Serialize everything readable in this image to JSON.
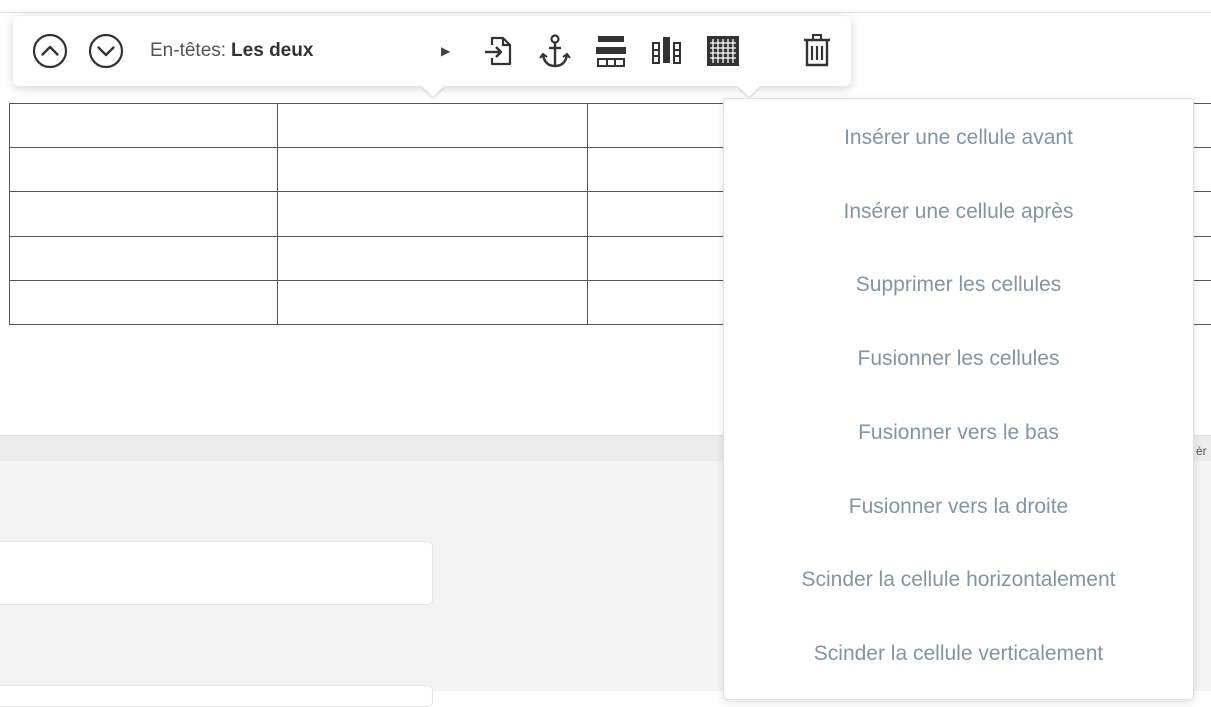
{
  "toolbar": {
    "headers_label": "En-têtes:",
    "headers_value": "Les deux",
    "icons": [
      "circle-chevron-up-icon",
      "circle-chevron-down-icon",
      "caret-right-icon",
      "insert-file-icon",
      "anchor-icon",
      "table-rows-icon",
      "table-columns-icon",
      "table-cells-icon",
      "trash-icon"
    ]
  },
  "table": {
    "rows": 5,
    "columns": 4
  },
  "cell_menu": {
    "items": [
      {
        "label": "Insérer une cellule avant"
      },
      {
        "label": "Insérer une cellule après"
      },
      {
        "label": "Supprimer les cellules"
      },
      {
        "label": "Fusionner les cellules"
      },
      {
        "label": "Fusionner vers le bas"
      },
      {
        "label": "Fusionner vers la droite"
      },
      {
        "label": "Scinder la cellule horizontalement"
      },
      {
        "label": "Scinder la cellule verticalement"
      }
    ]
  },
  "edge_text": "èr",
  "colors": {
    "menu_text": "#8395a1",
    "icon": "#333333",
    "border": "#555555"
  }
}
